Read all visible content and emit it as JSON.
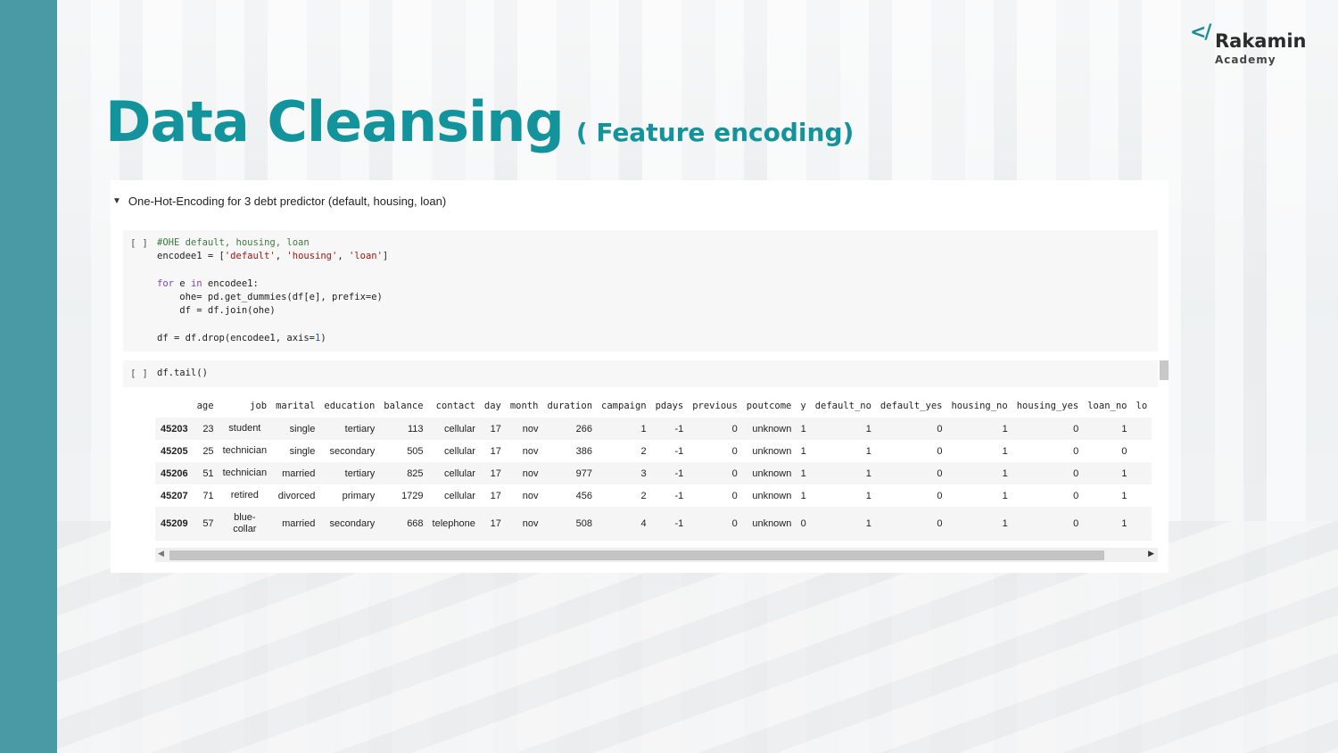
{
  "logo": {
    "mark": "</",
    "name": "Rakamin",
    "sub": "Academy"
  },
  "title": {
    "main": "Data Cleansing",
    "sub": "( Feature encoding)"
  },
  "section": {
    "heading": "One-Hot-Encoding for 3 debt predictor (default, housing, loan)"
  },
  "cells": {
    "cell1_run": "[ ]",
    "cell2_run": "[ ]",
    "cell2_code": "df.tail()"
  },
  "table": {
    "columns": [
      "",
      "age",
      "job",
      "marital",
      "education",
      "balance",
      "contact",
      "day",
      "month",
      "duration",
      "campaign",
      "pdays",
      "previous",
      "poutcome",
      "y",
      "default_no",
      "default_yes",
      "housing_no",
      "housing_yes",
      "loan_no",
      "lo"
    ],
    "rows": [
      [
        "45203",
        "23",
        "student",
        "single",
        "tertiary",
        "113",
        "cellular",
        "17",
        "nov",
        "266",
        "1",
        "-1",
        "0",
        "unknown",
        "1",
        "1",
        "0",
        "1",
        "0",
        "1",
        ""
      ],
      [
        "45205",
        "25",
        "technician",
        "single",
        "secondary",
        "505",
        "cellular",
        "17",
        "nov",
        "386",
        "2",
        "-1",
        "0",
        "unknown",
        "1",
        "1",
        "0",
        "1",
        "0",
        "0",
        ""
      ],
      [
        "45206",
        "51",
        "technician",
        "married",
        "tertiary",
        "825",
        "cellular",
        "17",
        "nov",
        "977",
        "3",
        "-1",
        "0",
        "unknown",
        "1",
        "1",
        "0",
        "1",
        "0",
        "1",
        ""
      ],
      [
        "45207",
        "71",
        "retired",
        "divorced",
        "primary",
        "1729",
        "cellular",
        "17",
        "nov",
        "456",
        "2",
        "-1",
        "0",
        "unknown",
        "1",
        "1",
        "0",
        "1",
        "0",
        "1",
        ""
      ],
      [
        "45209",
        "57",
        "blue-collar",
        "married",
        "secondary",
        "668",
        "telephone",
        "17",
        "nov",
        "508",
        "4",
        "-1",
        "0",
        "unknown",
        "0",
        "1",
        "0",
        "1",
        "0",
        "1",
        ""
      ]
    ]
  },
  "colors": {
    "accent": "#13949c",
    "side_bar": "#4a9aa6"
  },
  "icons": {
    "section_toggle": "caret-down-icon",
    "scroll_left": "arrow-left-icon",
    "scroll_right": "arrow-right-icon"
  }
}
